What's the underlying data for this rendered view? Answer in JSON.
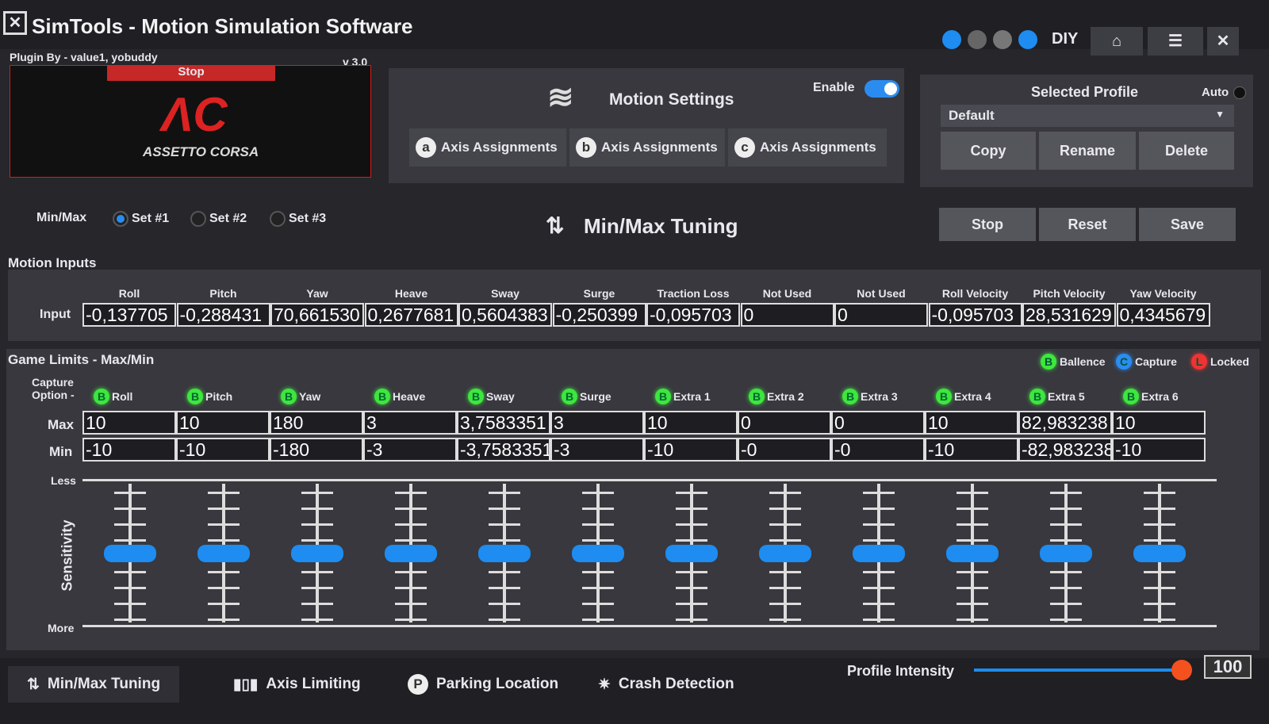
{
  "window": {
    "title": "SimTools - Motion Simulation Software",
    "diy": "DIY"
  },
  "plugin": {
    "by": "Plugin By - value1, yobuddy",
    "version": "v 3.0",
    "status": "Stop",
    "game": "ASSETTO CORSA"
  },
  "motion_settings": {
    "title": "Motion Settings",
    "enable_label": "Enable",
    "enabled": true,
    "axis_buttons": [
      {
        "letter": "a",
        "label": "Axis Assignments"
      },
      {
        "letter": "b",
        "label": "Axis Assignments"
      },
      {
        "letter": "c",
        "label": "Axis Assignments"
      }
    ]
  },
  "profile": {
    "title": "Selected Profile",
    "auto_label": "Auto",
    "selected": "Default",
    "copy": "Copy",
    "rename": "Rename",
    "delete": "Delete"
  },
  "minmax": {
    "label": "Min/Max",
    "sets": [
      "Set #1",
      "Set #2",
      "Set #3"
    ],
    "selected_set": 0,
    "title": "Min/Max Tuning",
    "stop": "Stop",
    "reset": "Reset",
    "save": "Save"
  },
  "motion_inputs": {
    "title": "Motion Inputs",
    "row_label": "Input",
    "columns": [
      "Roll",
      "Pitch",
      "Yaw",
      "Heave",
      "Sway",
      "Surge",
      "Traction Loss",
      "Not Used",
      "Not Used",
      "Roll Velocity",
      "Pitch Velocity",
      "Yaw Velocity"
    ],
    "values": [
      "-0,137705",
      "-0,288431",
      "70,661530",
      "0,2677681",
      "0,5604383",
      "-0,250399",
      "-0,095703",
      "0",
      "0",
      "-0,095703",
      "28,531629",
      "0,4345679"
    ]
  },
  "game_limits": {
    "title": "Game Limits - Max/Min",
    "capture_label": "Capture Option -",
    "legend": [
      {
        "letter": "B",
        "label": "Ballence",
        "color": "#3ee63e"
      },
      {
        "letter": "C",
        "label": "Capture",
        "color": "#2b8cf0"
      },
      {
        "letter": "L",
        "label": "Locked",
        "color": "#ee3333"
      }
    ],
    "max_label": "Max",
    "min_label": "Min",
    "less_label": "Less",
    "more_label": "More",
    "sensitivity_label": "Sensitivity",
    "axes": [
      {
        "name": "Roll",
        "max": "10",
        "min": "-10",
        "sensitivity": 0.5
      },
      {
        "name": "Pitch",
        "max": "10",
        "min": "-10",
        "sensitivity": 0.5
      },
      {
        "name": "Yaw",
        "max": "180",
        "min": "-180",
        "sensitivity": 0.5
      },
      {
        "name": "Heave",
        "max": "3",
        "min": "-3",
        "sensitivity": 0.5
      },
      {
        "name": "Sway",
        "max": "3,7583351",
        "min": "-3,7583351",
        "sensitivity": 0.5
      },
      {
        "name": "Surge",
        "max": "3",
        "min": "-3",
        "sensitivity": 0.5
      },
      {
        "name": "Extra 1",
        "max": "10",
        "min": "-10",
        "sensitivity": 0.5
      },
      {
        "name": "Extra 2",
        "max": "0",
        "min": "-0",
        "sensitivity": 0.5
      },
      {
        "name": "Extra 3",
        "max": "0",
        "min": "-0",
        "sensitivity": 0.5
      },
      {
        "name": "Extra 4",
        "max": "10",
        "min": "-10",
        "sensitivity": 0.5
      },
      {
        "name": "Extra 5",
        "max": "82,983238",
        "min": "-82,983238",
        "sensitivity": 0.5
      },
      {
        "name": "Extra 6",
        "max": "10",
        "min": "-10",
        "sensitivity": 0.5
      }
    ]
  },
  "bottom": {
    "tabs": [
      "Min/Max Tuning",
      "Axis Limiting",
      "Parking Location",
      "Crash Detection"
    ],
    "intensity_label": "Profile Intensity",
    "intensity": "100"
  }
}
